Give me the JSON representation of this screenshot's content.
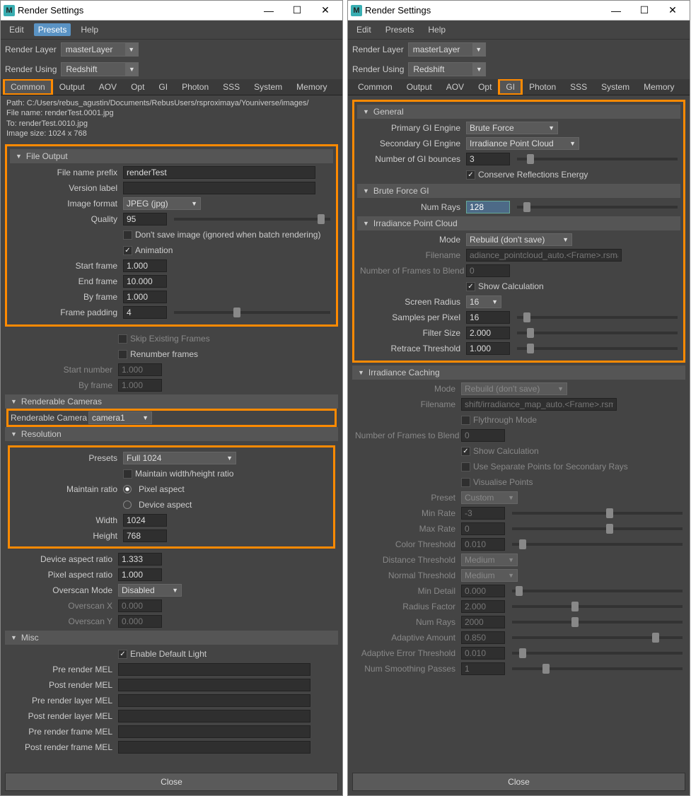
{
  "app_title": "Render Settings",
  "menus": {
    "edit": "Edit",
    "presets": "Presets",
    "help": "Help"
  },
  "render_layer_lbl": "Render Layer",
  "render_layer_val": "masterLayer",
  "render_using_lbl": "Render Using",
  "render_using_val": "Redshift",
  "tabs": [
    "Common",
    "Output",
    "AOV",
    "Opt",
    "GI",
    "Photon",
    "SSS",
    "System",
    "Memory"
  ],
  "left": {
    "info_path": "Path: C:/Users/rebus_agustin/Documents/RebusUsers/rsproximaya/Youniverse/images/",
    "info_file": "File name:  renderTest.0001.jpg",
    "info_to": "To:              renderTest.0010.jpg",
    "info_size": "Image size: 1024 x 768",
    "file_output": {
      "header": "File Output",
      "prefix_lbl": "File name prefix",
      "prefix_val": "renderTest",
      "version_lbl": "Version label",
      "version_val": "",
      "format_lbl": "Image format",
      "format_val": "JPEG (jpg)",
      "quality_lbl": "Quality",
      "quality_val": "95",
      "dontsave_lbl": "Don't save image (ignored when batch rendering)",
      "anim_lbl": "Animation",
      "start_lbl": "Start frame",
      "start_val": "1.000",
      "end_lbl": "End frame",
      "end_val": "10.000",
      "by_lbl": "By frame",
      "by_val": "1.000",
      "pad_lbl": "Frame padding",
      "pad_val": "4"
    },
    "skip_lbl": "Skip Existing Frames",
    "renum_lbl": "Renumber frames",
    "startnum_lbl": "Start number",
    "startnum_val": "1.000",
    "byframe2_lbl": "By frame",
    "byframe2_val": "1.000",
    "cameras_h": "Renderable Cameras",
    "cam_lbl": "Renderable Camera",
    "cam_val": "camera1",
    "res_h": "Resolution",
    "presets_lbl": "Presets",
    "presets_val": "Full 1024",
    "maint_lbl": "Maintain width/height ratio",
    "maint_ratio_lbl": "Maintain ratio",
    "pixel_aspect": "Pixel aspect",
    "device_aspect": "Device aspect",
    "width_lbl": "Width",
    "width_val": "1024",
    "height_lbl": "Height",
    "height_val": "768",
    "dar_lbl": "Device aspect ratio",
    "dar_val": "1.333",
    "par_lbl": "Pixel aspect ratio",
    "par_val": "1.000",
    "over_mode_lbl": "Overscan Mode",
    "over_mode_val": "Disabled",
    "over_x_lbl": "Overscan X",
    "over_x_val": "0.000",
    "over_y_lbl": "Overscan Y",
    "over_y_val": "0.000",
    "misc_h": "Misc",
    "edl_lbl": "Enable Default Light",
    "mel": {
      "pre": "Pre render MEL",
      "post": "Post render MEL",
      "prel": "Pre render layer MEL",
      "postl": "Post render layer MEL",
      "pref": "Pre render frame MEL",
      "postf": "Post render frame MEL"
    }
  },
  "right": {
    "general_h": "General",
    "pgi_lbl": "Primary GI Engine",
    "pgi_val": "Brute Force",
    "sgi_lbl": "Secondary GI Engine",
    "sgi_val": "Irradiance Point Cloud",
    "ngi_lbl": "Number of GI bounces",
    "ngi_val": "3",
    "cre_lbl": "Conserve Reflections Energy",
    "bf_h": "Brute Force GI",
    "numrays_lbl": "Num Rays",
    "numrays_val": "128",
    "ipc_h": "Irradiance Point Cloud",
    "mode_lbl": "Mode",
    "mode_val": "Rebuild (don't save)",
    "fn_lbl": "Filename",
    "fn_val": "adiance_pointcloud_auto.<Frame>.rsmap",
    "nfb_lbl": "Number of Frames to Blend",
    "nfb_val": "0",
    "showcalc_lbl": "Show Calculation",
    "sr_lbl": "Screen Radius",
    "sr_val": "16",
    "spp_lbl": "Samples per Pixel",
    "spp_val": "16",
    "fs_lbl": "Filter Size",
    "fs_val": "2.000",
    "rt_lbl": "Retrace Threshold",
    "rt_val": "1.000",
    "ic_h": "Irradiance Caching",
    "ic_mode_val": "Rebuild (don't save)",
    "ic_fn_val": "shift/irradiance_map_auto.<Frame>.rsmap",
    "fly_lbl": "Flythrough Mode",
    "usep_lbl": "Use Separate Points for Secondary Rays",
    "visp_lbl": "Visualise Points",
    "preset_lbl": "Preset",
    "preset_val": "Custom",
    "minr_lbl": "Min Rate",
    "minr_val": "-3",
    "maxr_lbl": "Max Rate",
    "maxr_val": "0",
    "ct_lbl": "Color Threshold",
    "ct_val": "0.010",
    "dt_lbl": "Distance Threshold",
    "dt_val": "Medium",
    "nt_lbl": "Normal Threshold",
    "nt_val": "Medium",
    "md_lbl": "Min Detail",
    "md_val": "0.000",
    "rf_lbl": "Radius Factor",
    "rf_val": "2.000",
    "nr_lbl": "Num Rays",
    "nr_val": "2000",
    "aa_lbl": "Adaptive Amount",
    "aa_val": "0.850",
    "aet_lbl": "Adaptive Error Threshold",
    "aet_val": "0.010",
    "nsp_lbl": "Num Smoothing Passes",
    "nsp_val": "1"
  },
  "close_lbl": "Close"
}
